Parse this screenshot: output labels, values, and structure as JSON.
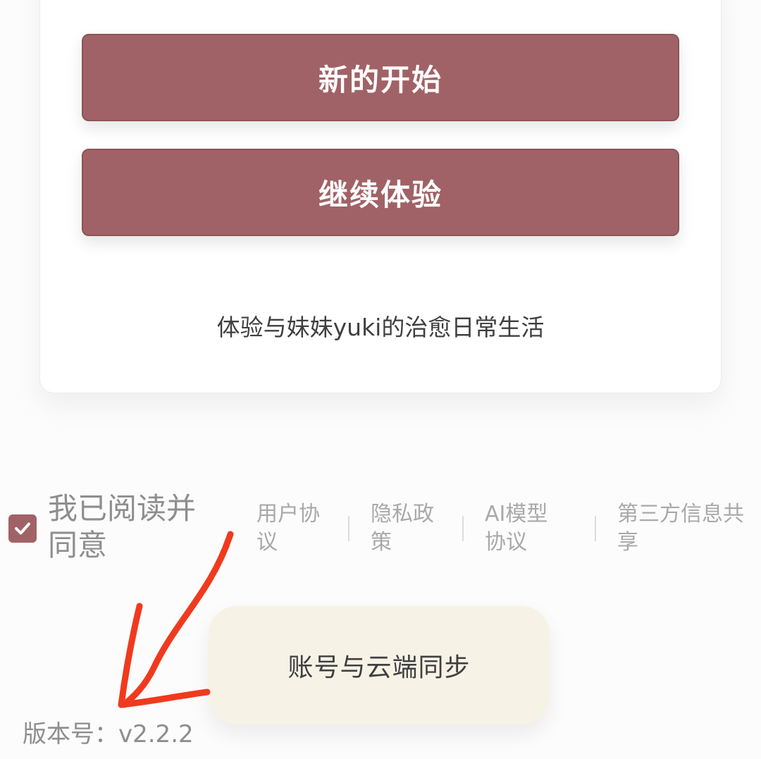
{
  "buttons": {
    "new_start": "新的开始",
    "continue": "继续体验"
  },
  "tagline": "体验与妹妹yuki的治愈日常生活",
  "agreement": {
    "checked": true,
    "text": "我已阅读并同意",
    "links": [
      "用户协议",
      "隐私政策",
      "AI模型协议",
      "第三方信息共享"
    ]
  },
  "sync_button": "账号与云端同步",
  "version": "版本号：v2.2.2",
  "annotation": {
    "type": "arrow",
    "color": "#f03a1e"
  },
  "colors": {
    "primary": "#a06266",
    "sync_bg": "#f6f2e6"
  }
}
